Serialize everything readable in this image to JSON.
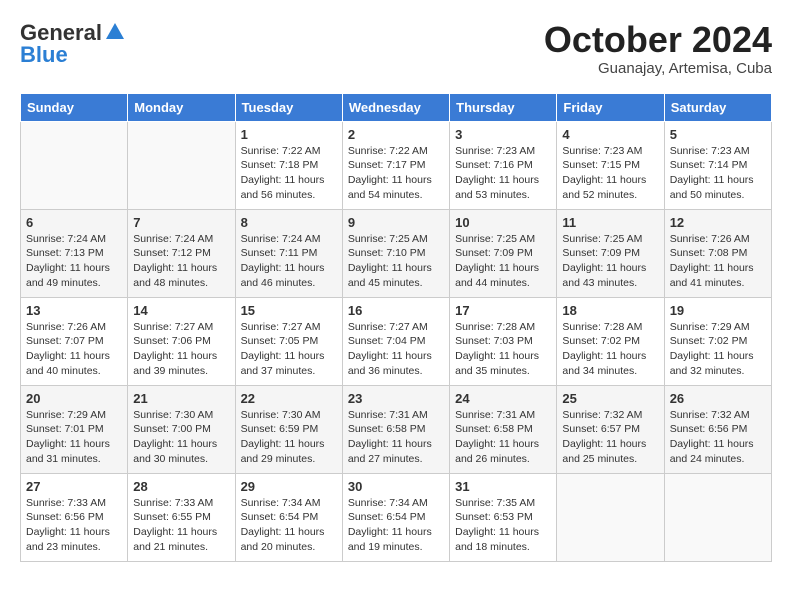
{
  "logo": {
    "general": "General",
    "blue": "Blue"
  },
  "title": "October 2024",
  "subtitle": "Guanajay, Artemisa, Cuba",
  "days_of_week": [
    "Sunday",
    "Monday",
    "Tuesday",
    "Wednesday",
    "Thursday",
    "Friday",
    "Saturday"
  ],
  "weeks": [
    [
      {
        "day": "",
        "sunrise": "",
        "sunset": "",
        "daylight": "",
        "empty": true
      },
      {
        "day": "",
        "sunrise": "",
        "sunset": "",
        "daylight": "",
        "empty": true
      },
      {
        "day": "1",
        "sunrise": "Sunrise: 7:22 AM",
        "sunset": "Sunset: 7:18 PM",
        "daylight": "Daylight: 11 hours and 56 minutes."
      },
      {
        "day": "2",
        "sunrise": "Sunrise: 7:22 AM",
        "sunset": "Sunset: 7:17 PM",
        "daylight": "Daylight: 11 hours and 54 minutes."
      },
      {
        "day": "3",
        "sunrise": "Sunrise: 7:23 AM",
        "sunset": "Sunset: 7:16 PM",
        "daylight": "Daylight: 11 hours and 53 minutes."
      },
      {
        "day": "4",
        "sunrise": "Sunrise: 7:23 AM",
        "sunset": "Sunset: 7:15 PM",
        "daylight": "Daylight: 11 hours and 52 minutes."
      },
      {
        "day": "5",
        "sunrise": "Sunrise: 7:23 AM",
        "sunset": "Sunset: 7:14 PM",
        "daylight": "Daylight: 11 hours and 50 minutes."
      }
    ],
    [
      {
        "day": "6",
        "sunrise": "Sunrise: 7:24 AM",
        "sunset": "Sunset: 7:13 PM",
        "daylight": "Daylight: 11 hours and 49 minutes."
      },
      {
        "day": "7",
        "sunrise": "Sunrise: 7:24 AM",
        "sunset": "Sunset: 7:12 PM",
        "daylight": "Daylight: 11 hours and 48 minutes."
      },
      {
        "day": "8",
        "sunrise": "Sunrise: 7:24 AM",
        "sunset": "Sunset: 7:11 PM",
        "daylight": "Daylight: 11 hours and 46 minutes."
      },
      {
        "day": "9",
        "sunrise": "Sunrise: 7:25 AM",
        "sunset": "Sunset: 7:10 PM",
        "daylight": "Daylight: 11 hours and 45 minutes."
      },
      {
        "day": "10",
        "sunrise": "Sunrise: 7:25 AM",
        "sunset": "Sunset: 7:09 PM",
        "daylight": "Daylight: 11 hours and 44 minutes."
      },
      {
        "day": "11",
        "sunrise": "Sunrise: 7:25 AM",
        "sunset": "Sunset: 7:09 PM",
        "daylight": "Daylight: 11 hours and 43 minutes."
      },
      {
        "day": "12",
        "sunrise": "Sunrise: 7:26 AM",
        "sunset": "Sunset: 7:08 PM",
        "daylight": "Daylight: 11 hours and 41 minutes."
      }
    ],
    [
      {
        "day": "13",
        "sunrise": "Sunrise: 7:26 AM",
        "sunset": "Sunset: 7:07 PM",
        "daylight": "Daylight: 11 hours and 40 minutes."
      },
      {
        "day": "14",
        "sunrise": "Sunrise: 7:27 AM",
        "sunset": "Sunset: 7:06 PM",
        "daylight": "Daylight: 11 hours and 39 minutes."
      },
      {
        "day": "15",
        "sunrise": "Sunrise: 7:27 AM",
        "sunset": "Sunset: 7:05 PM",
        "daylight": "Daylight: 11 hours and 37 minutes."
      },
      {
        "day": "16",
        "sunrise": "Sunrise: 7:27 AM",
        "sunset": "Sunset: 7:04 PM",
        "daylight": "Daylight: 11 hours and 36 minutes."
      },
      {
        "day": "17",
        "sunrise": "Sunrise: 7:28 AM",
        "sunset": "Sunset: 7:03 PM",
        "daylight": "Daylight: 11 hours and 35 minutes."
      },
      {
        "day": "18",
        "sunrise": "Sunrise: 7:28 AM",
        "sunset": "Sunset: 7:02 PM",
        "daylight": "Daylight: 11 hours and 34 minutes."
      },
      {
        "day": "19",
        "sunrise": "Sunrise: 7:29 AM",
        "sunset": "Sunset: 7:02 PM",
        "daylight": "Daylight: 11 hours and 32 minutes."
      }
    ],
    [
      {
        "day": "20",
        "sunrise": "Sunrise: 7:29 AM",
        "sunset": "Sunset: 7:01 PM",
        "daylight": "Daylight: 11 hours and 31 minutes."
      },
      {
        "day": "21",
        "sunrise": "Sunrise: 7:30 AM",
        "sunset": "Sunset: 7:00 PM",
        "daylight": "Daylight: 11 hours and 30 minutes."
      },
      {
        "day": "22",
        "sunrise": "Sunrise: 7:30 AM",
        "sunset": "Sunset: 6:59 PM",
        "daylight": "Daylight: 11 hours and 29 minutes."
      },
      {
        "day": "23",
        "sunrise": "Sunrise: 7:31 AM",
        "sunset": "Sunset: 6:58 PM",
        "daylight": "Daylight: 11 hours and 27 minutes."
      },
      {
        "day": "24",
        "sunrise": "Sunrise: 7:31 AM",
        "sunset": "Sunset: 6:58 PM",
        "daylight": "Daylight: 11 hours and 26 minutes."
      },
      {
        "day": "25",
        "sunrise": "Sunrise: 7:32 AM",
        "sunset": "Sunset: 6:57 PM",
        "daylight": "Daylight: 11 hours and 25 minutes."
      },
      {
        "day": "26",
        "sunrise": "Sunrise: 7:32 AM",
        "sunset": "Sunset: 6:56 PM",
        "daylight": "Daylight: 11 hours and 24 minutes."
      }
    ],
    [
      {
        "day": "27",
        "sunrise": "Sunrise: 7:33 AM",
        "sunset": "Sunset: 6:56 PM",
        "daylight": "Daylight: 11 hours and 23 minutes."
      },
      {
        "day": "28",
        "sunrise": "Sunrise: 7:33 AM",
        "sunset": "Sunset: 6:55 PM",
        "daylight": "Daylight: 11 hours and 21 minutes."
      },
      {
        "day": "29",
        "sunrise": "Sunrise: 7:34 AM",
        "sunset": "Sunset: 6:54 PM",
        "daylight": "Daylight: 11 hours and 20 minutes."
      },
      {
        "day": "30",
        "sunrise": "Sunrise: 7:34 AM",
        "sunset": "Sunset: 6:54 PM",
        "daylight": "Daylight: 11 hours and 19 minutes."
      },
      {
        "day": "31",
        "sunrise": "Sunrise: 7:35 AM",
        "sunset": "Sunset: 6:53 PM",
        "daylight": "Daylight: 11 hours and 18 minutes."
      },
      {
        "day": "",
        "sunrise": "",
        "sunset": "",
        "daylight": "",
        "empty": true
      },
      {
        "day": "",
        "sunrise": "",
        "sunset": "",
        "daylight": "",
        "empty": true
      }
    ]
  ]
}
